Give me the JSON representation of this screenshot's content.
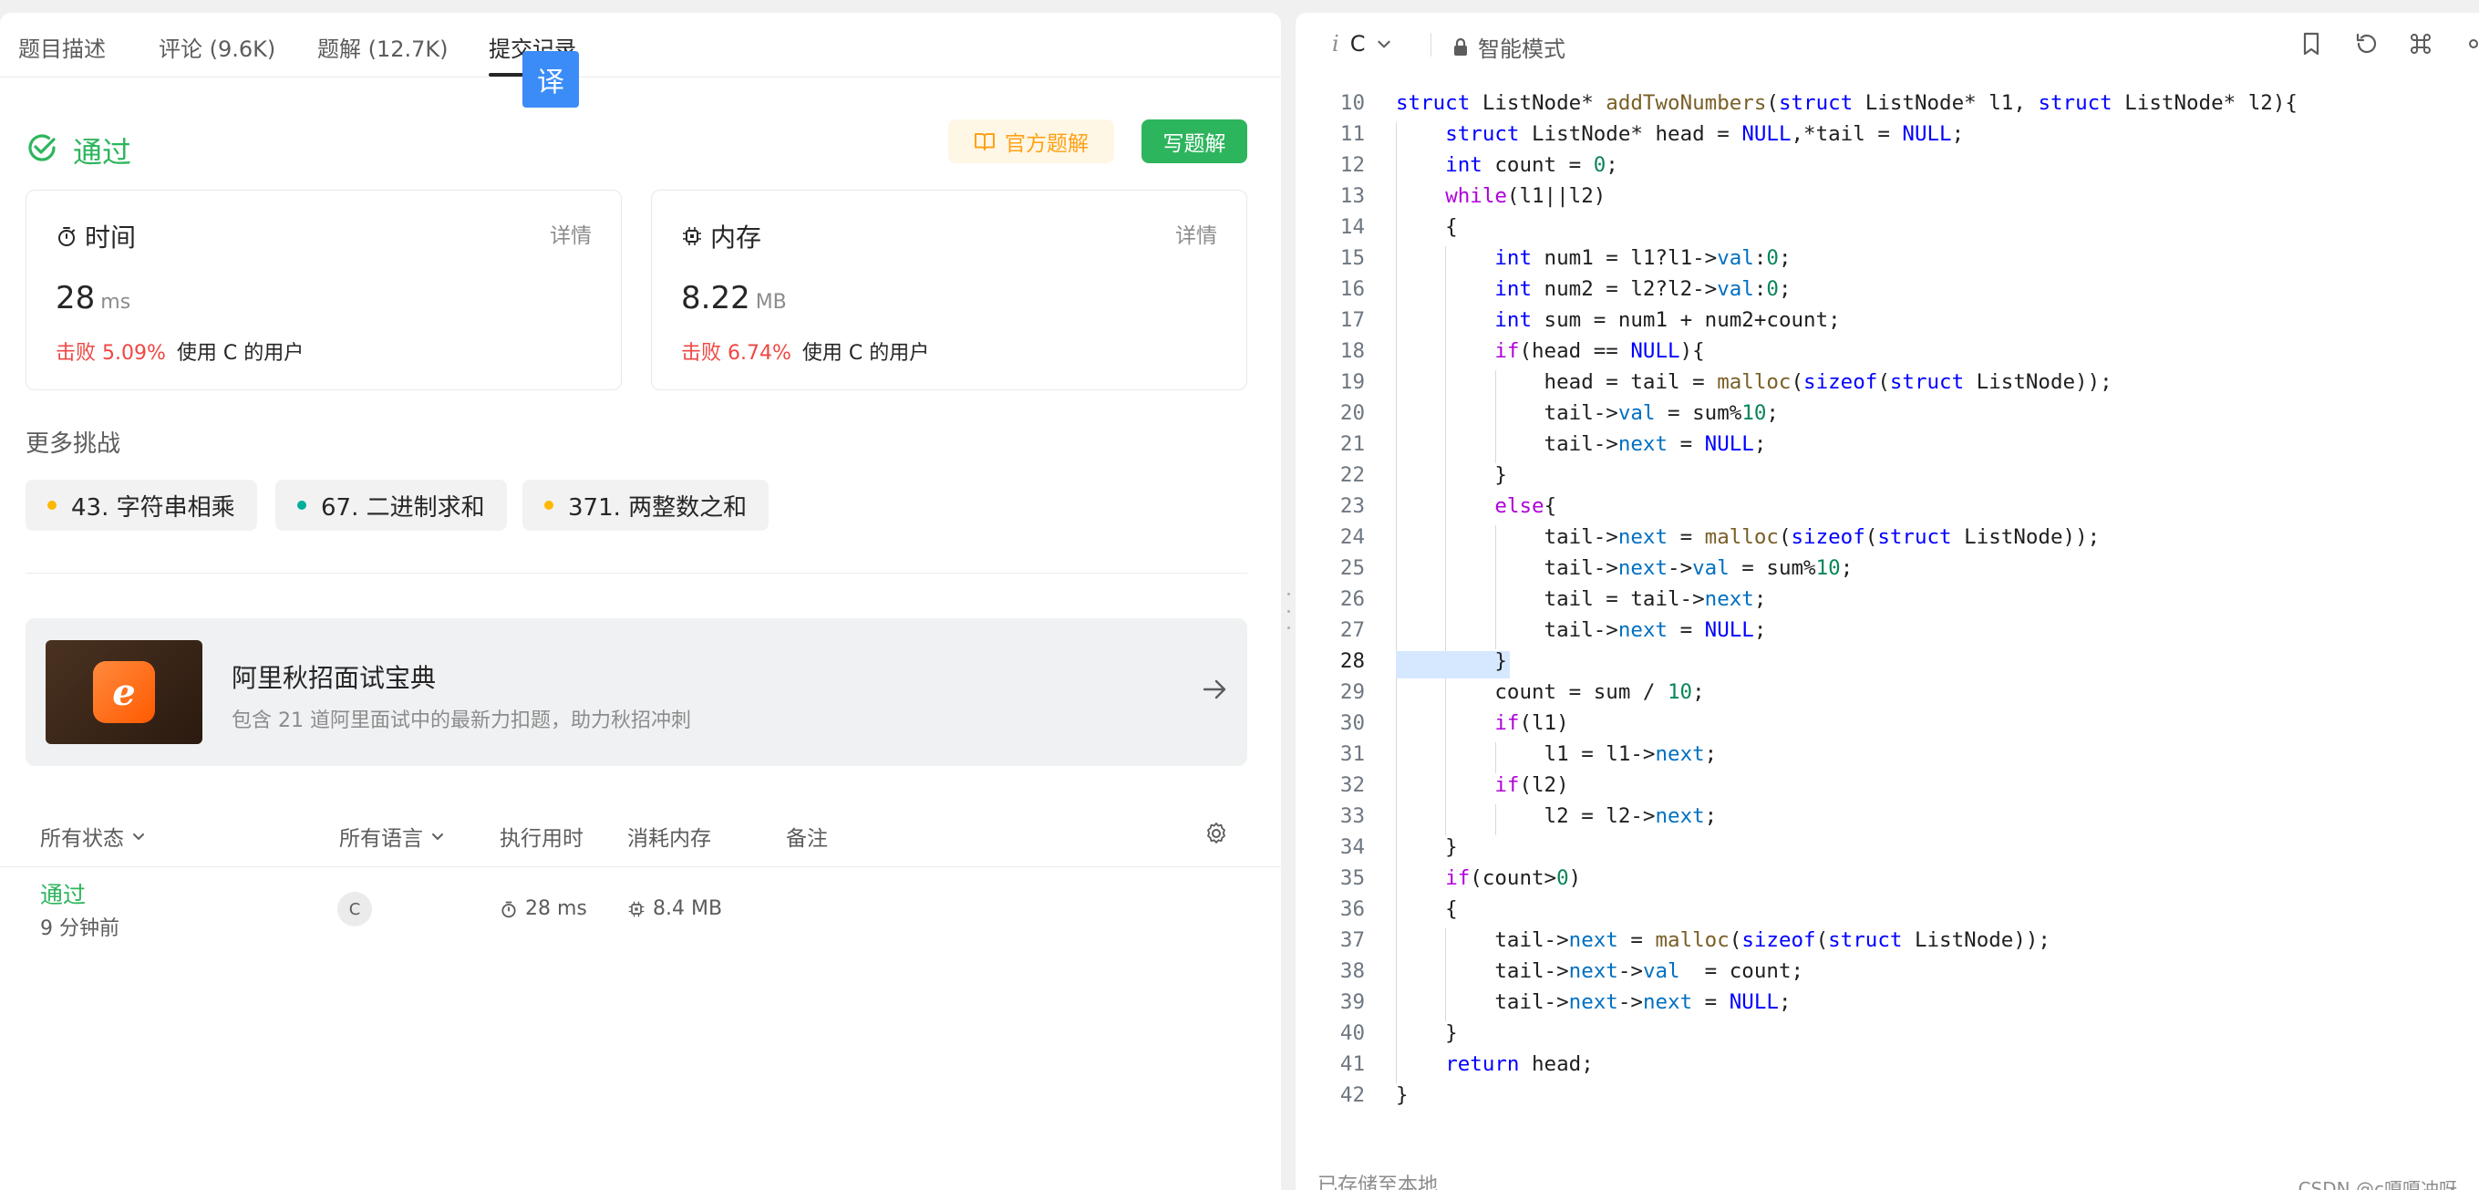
{
  "tabs": [
    {
      "label": "题目描述",
      "active": false
    },
    {
      "label": "评论 (9.6K)",
      "active": false
    },
    {
      "label": "题解 (12.7K)",
      "active": false
    },
    {
      "label": "提交记录",
      "active": true
    }
  ],
  "translate_badge": "译",
  "result": {
    "status": "通过",
    "official_solution_label": "官方题解",
    "write_solution_label": "写题解",
    "time": {
      "title": "时间",
      "detail": "详情",
      "value": "28",
      "unit": "ms",
      "beat": "击败 5.09%",
      "beat_suffix": "使用 C 的用户"
    },
    "memory": {
      "title": "内存",
      "detail": "详情",
      "value": "8.22",
      "unit": "MB",
      "beat": "击败 6.74%",
      "beat_suffix": "使用 C 的用户"
    }
  },
  "more": {
    "title": "更多挑战",
    "items": [
      {
        "label": "43. 字符串相乘",
        "color": "#ffb800"
      },
      {
        "label": "67. 二进制求和",
        "color": "#00af9b"
      },
      {
        "label": "371. 两整数之和",
        "color": "#ffb800"
      }
    ]
  },
  "promo": {
    "logo_text": "e",
    "title": "阿里秋招面试宝典",
    "subtitle": "包含 21 道阿里面试中的最新力扣题，助力秋招冲刺"
  },
  "filters": {
    "status": "所有状态",
    "language": "所有语言",
    "runtime": "执行用时",
    "memory": "消耗内存",
    "notes": "备注"
  },
  "submission": {
    "status": "通过",
    "time_ago": "9 分钟前",
    "lang": "C",
    "runtime": "28 ms",
    "memory": "8.4 MB"
  },
  "editor": {
    "language": "C",
    "mode": "智能模式",
    "saved": "已存储至本地",
    "watermark": "CSDN @c嘎嘎冲呀",
    "current_line": 28,
    "lines": [
      {
        "n": "10",
        "code": "struct ListNode* addTwoNumbers(struct ListNode* l1, struct ListNode* l2){"
      },
      {
        "n": "11",
        "code": "    struct ListNode* head = NULL,*tail = NULL;"
      },
      {
        "n": "12",
        "code": "    int count = 0;"
      },
      {
        "n": "13",
        "code": "    while(l1||l2)"
      },
      {
        "n": "14",
        "code": "    {"
      },
      {
        "n": "15",
        "code": "        int num1 = l1?l1->val:0;"
      },
      {
        "n": "16",
        "code": "        int num2 = l2?l2->val:0;"
      },
      {
        "n": "17",
        "code": "        int sum = num1 + num2+count;"
      },
      {
        "n": "18",
        "code": "        if(head == NULL){"
      },
      {
        "n": "19",
        "code": "            head = tail = malloc(sizeof(struct ListNode));"
      },
      {
        "n": "20",
        "code": "            tail->val = sum%10;"
      },
      {
        "n": "21",
        "code": "            tail->next = NULL;"
      },
      {
        "n": "22",
        "code": "        }"
      },
      {
        "n": "23",
        "code": "        else{"
      },
      {
        "n": "24",
        "code": "            tail->next = malloc(sizeof(struct ListNode));"
      },
      {
        "n": "25",
        "code": "            tail->next->val = sum%10;"
      },
      {
        "n": "26",
        "code": "            tail = tail->next;"
      },
      {
        "n": "27",
        "code": "            tail->next = NULL;"
      },
      {
        "n": "28",
        "code": "        }"
      },
      {
        "n": "29",
        "code": "        count = sum / 10;"
      },
      {
        "n": "30",
        "code": "        if(l1)"
      },
      {
        "n": "31",
        "code": "            l1 = l1->next;"
      },
      {
        "n": "32",
        "code": "        if(l2)"
      },
      {
        "n": "33",
        "code": "            l2 = l2->next;"
      },
      {
        "n": "34",
        "code": "    }"
      },
      {
        "n": "35",
        "code": "    if(count>0)"
      },
      {
        "n": "36",
        "code": "    {"
      },
      {
        "n": "37",
        "code": "        tail->next = malloc(sizeof(struct ListNode));"
      },
      {
        "n": "38",
        "code": "        tail->next->val  = count;"
      },
      {
        "n": "39",
        "code": "        tail->next->next = NULL;"
      },
      {
        "n": "40",
        "code": "    }"
      },
      {
        "n": "41",
        "code": "    return head;"
      },
      {
        "n": "42",
        "code": "}"
      }
    ]
  }
}
